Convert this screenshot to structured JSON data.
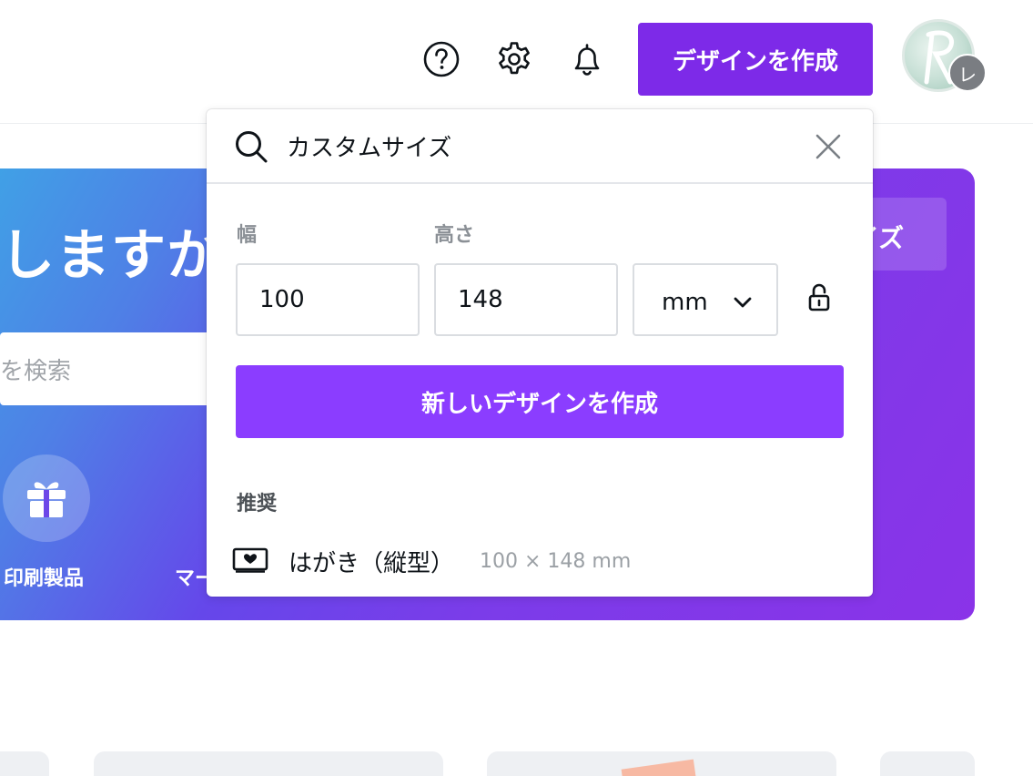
{
  "header": {
    "create_button_label": "デザインを作成",
    "avatar_badge": "レ",
    "icons": [
      "help-icon",
      "gear-icon",
      "bell-icon"
    ]
  },
  "hero": {
    "title": "しますか",
    "search_placeholder": "を検索",
    "side_button_label": "イズ",
    "categories": [
      {
        "label": "印刷製品",
        "icon": "gift-icon"
      },
      {
        "label": "マー"
      }
    ]
  },
  "popup": {
    "search_value": "カスタムサイズ",
    "width_label": "幅",
    "height_label": "高さ",
    "width_value": "100",
    "height_value": "148",
    "unit": "mm",
    "new_design_label": "新しいデザインを作成",
    "recommended_heading": "推奨",
    "recommended": [
      {
        "name": "はがき（縦型）",
        "size": "100 × 148 mm",
        "icon": "postcard-icon"
      }
    ]
  },
  "colors": {
    "primary_purple": "#7d2ae8",
    "button_purple": "#8b3dff"
  }
}
